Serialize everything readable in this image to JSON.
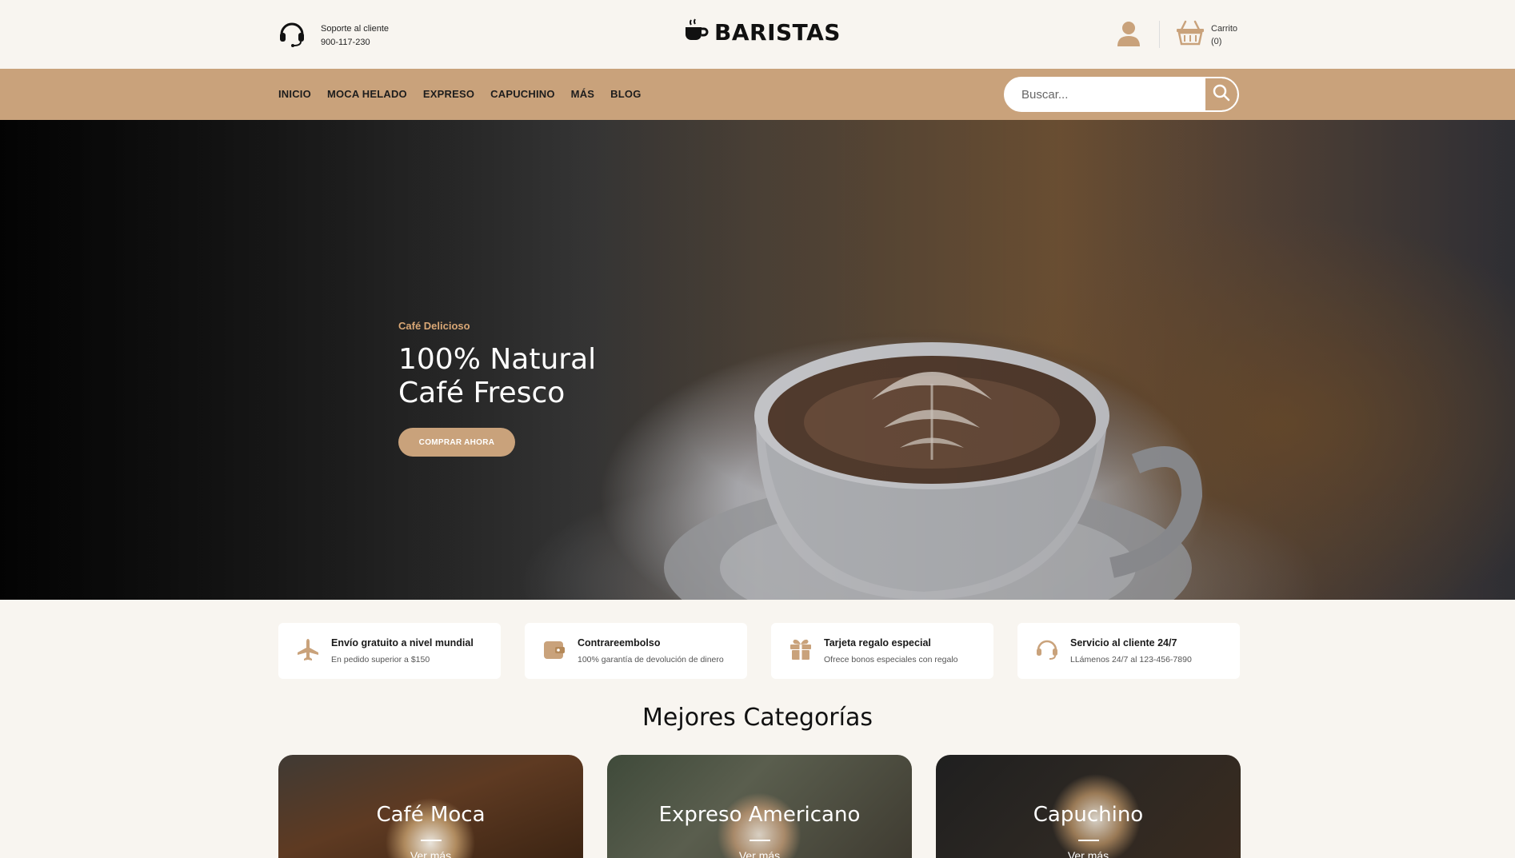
{
  "header": {
    "support_label": "Soporte al cliente",
    "support_phone": "900-117-230",
    "logo_text": "BARISTAS",
    "cart_label": "Carrito",
    "cart_count": "(0)"
  },
  "nav": {
    "items": [
      "INICIO",
      "MOCA HELADO",
      "EXPRESO",
      "CAPUCHINO",
      "MÁS",
      "BLOG"
    ],
    "search_placeholder": "Buscar..."
  },
  "hero": {
    "kicker": "Café Delicioso",
    "title_line1": "100% Natural",
    "title_line2": "Café Fresco",
    "cta": "COMPRAR AHORA"
  },
  "features": [
    {
      "title": "Envío gratuito a nivel mundial",
      "subtitle": "En pedido superior a $150",
      "icon": "airplane-icon"
    },
    {
      "title": "Contrareembolso",
      "subtitle": "100% garantía de devolución de dinero",
      "icon": "wallet-icon"
    },
    {
      "title": "Tarjeta regalo especial",
      "subtitle": "Ofrece bonos especiales con regalo",
      "icon": "gift-icon"
    },
    {
      "title": "Servicio al cliente 24/7",
      "subtitle": "LLámenos 24/7 al 123-456-7890",
      "icon": "headset-icon"
    }
  ],
  "categories": {
    "title": "Mejores Categorías",
    "items": [
      {
        "name": "Café Moca",
        "link": "Ver más"
      },
      {
        "name": "Expreso Americano",
        "link": "Ver más"
      },
      {
        "name": "Capuchino",
        "link": "Ver más"
      }
    ]
  },
  "colors": {
    "accent": "#c9a27b",
    "background": "#f8f5f0",
    "text": "#1a1a1a"
  }
}
